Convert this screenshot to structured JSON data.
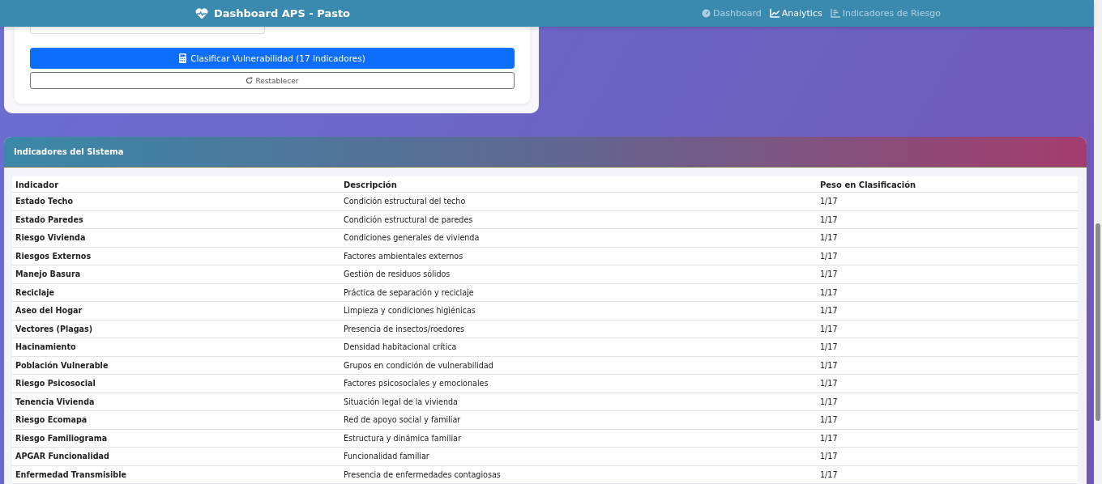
{
  "navbar": {
    "brand": "Dashboard APS - Pasto",
    "links": [
      {
        "label": "Dashboard",
        "selected": false
      },
      {
        "label": "Analytics",
        "selected": true
      },
      {
        "label": "Indicadores de Riesgo",
        "selected": false
      }
    ]
  },
  "form": {
    "classify_button": "Clasificar Vulnerabilidad (17 Indicadores)",
    "reset_button": "Restablecer"
  },
  "indicators_card": {
    "title": "Indicadores del Sistema",
    "table": {
      "columns": [
        "Indicador",
        "Descripción",
        "Peso en Clasificación"
      ],
      "rows": [
        [
          "Estado Techo",
          "Condición estructural del techo",
          "1/17"
        ],
        [
          "Estado Paredes",
          "Condición estructural de paredes",
          "1/17"
        ],
        [
          "Riesgo Vivienda",
          "Condiciones generales de vivienda",
          "1/17"
        ],
        [
          "Riesgos Externos",
          "Factores ambientales externos",
          "1/17"
        ],
        [
          "Manejo Basura",
          "Gestión de residuos sólidos",
          "1/17"
        ],
        [
          "Reciclaje",
          "Práctica de separación y reciclaje",
          "1/17"
        ],
        [
          "Aseo del Hogar",
          "Limpieza y condiciones higiénicas",
          "1/17"
        ],
        [
          "Vectores (Plagas)",
          "Presencia de insectos/roedores",
          "1/17"
        ],
        [
          "Hacinamiento",
          "Densidad habitacional crítica",
          "1/17"
        ],
        [
          "Población Vulnerable",
          "Grupos en condición de vulnerabilidad",
          "1/17"
        ],
        [
          "Riesgo Psicosocial",
          "Factores psicosociales y emocionales",
          "1/17"
        ],
        [
          "Tenencia Vivienda",
          "Situación legal de la vivienda",
          "1/17"
        ],
        [
          "Riesgo Ecomapa",
          "Red de apoyo social y familiar",
          "1/17"
        ],
        [
          "Riesgo Familiograma",
          "Estructura y dinámica familiar",
          "1/17"
        ],
        [
          "APGAR Funcionalidad",
          "Funcionalidad familiar",
          "1/17"
        ],
        [
          "Enfermedad Transmisible",
          "Presencia de enfermedades contagiosas",
          "1/17"
        ]
      ]
    }
  }
}
